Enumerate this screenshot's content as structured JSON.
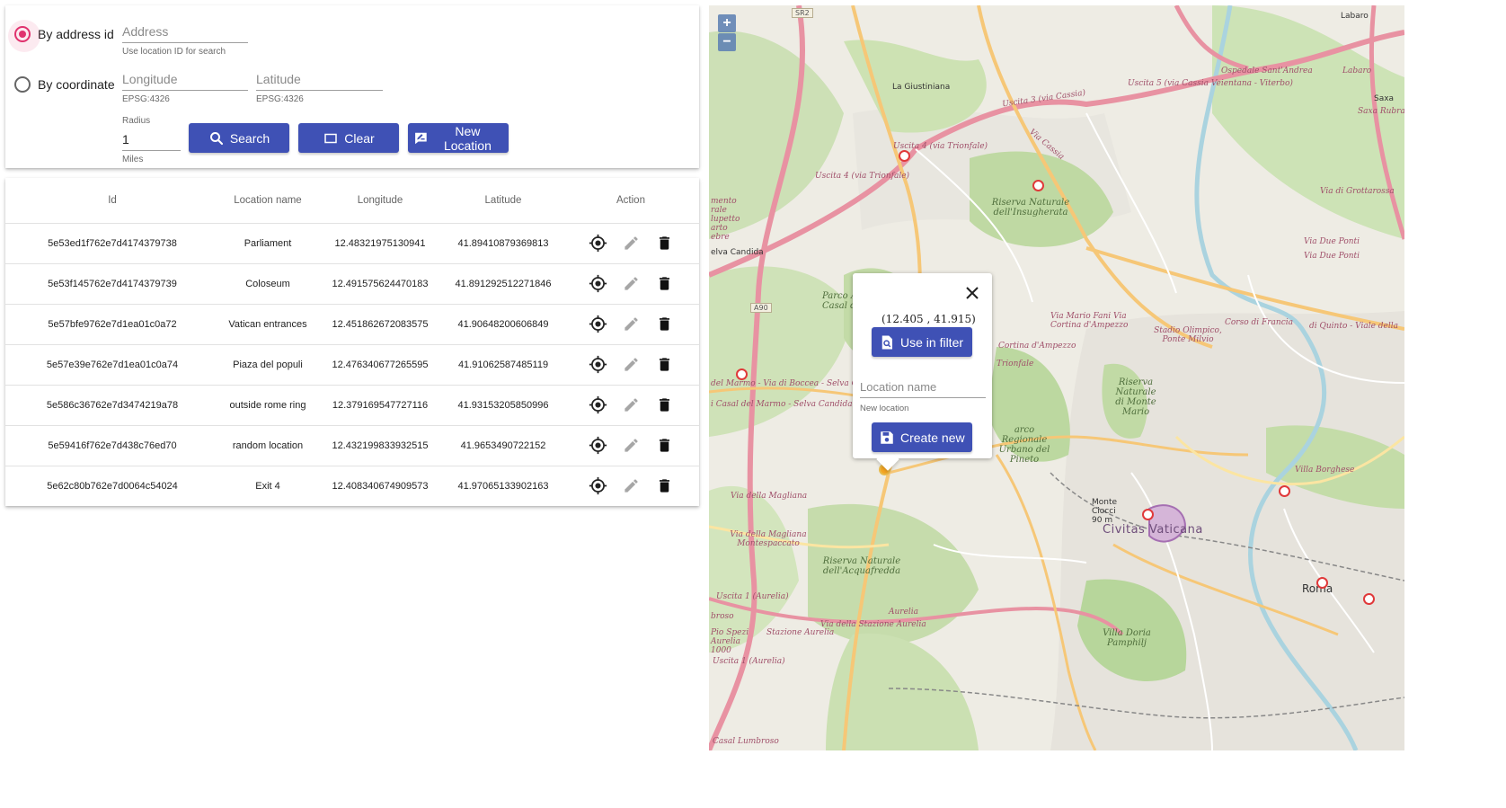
{
  "filter": {
    "mode_address_label": "By address id",
    "mode_coordinate_label": "By coordinate",
    "address_placeholder": "Address",
    "address_helper": "Use location ID for search",
    "longitude_placeholder": "Longitude",
    "longitude_helper": "EPSG:4326",
    "latitude_placeholder": "Latitude",
    "latitude_helper": "EPSG:4326",
    "radius_label": "Radius",
    "radius_value": "1",
    "radius_unit": "Miles",
    "search_label": "Search",
    "clear_label": "Clear",
    "new_location_label": "New Location",
    "accent_color": "#3f51b5",
    "radio_color": "#e0336f"
  },
  "table": {
    "headers": {
      "id": "Id",
      "name": "Location name",
      "longitude": "Longitude",
      "latitude": "Latitude",
      "action": "Action"
    },
    "rows": [
      {
        "id": "5e53ed1f762e7d4174379738",
        "name": "Parliament",
        "longitude": "12.48321975130941",
        "latitude": "41.89410879369813"
      },
      {
        "id": "5e53f145762e7d4174379739",
        "name": "Coloseum",
        "longitude": "12.491575624470183",
        "latitude": "41.891292512271846"
      },
      {
        "id": "5e57bfe9762e7d1ea01c0a72",
        "name": "Vatican entrances",
        "longitude": "12.451862672083575",
        "latitude": "41.90648200606849"
      },
      {
        "id": "5e57e39e762e7d1ea01c0a74",
        "name": "Piaza del populi",
        "longitude": "12.476340677265595",
        "latitude": "41.91062587485119"
      },
      {
        "id": "5e586c36762e7d3474219a78",
        "name": "outside rome ring",
        "longitude": "12.379169547727116",
        "latitude": "41.93153205850996"
      },
      {
        "id": "5e59416f762e7d438c76ed70",
        "name": "random location",
        "longitude": "12.432199833932515",
        "latitude": "41.9653490722152"
      },
      {
        "id": "5e62c80b762e7d0064c54024",
        "name": "Exit 4",
        "longitude": "12.408340674909573",
        "latitude": "41.97065133902163"
      }
    ]
  },
  "map": {
    "zoom_in": "+",
    "zoom_out": "−",
    "popup": {
      "coords": "(12.405 , 41.915)",
      "use_in_filter_label": "Use in filter",
      "location_name_placeholder": "Location name",
      "location_name_helper": "New location",
      "create_new_label": "Create new"
    },
    "labels": {
      "sr2": "SR2",
      "a90": "A90",
      "giustiniana": "La Giustiniana",
      "uscita3": "Uscita 3 (via Cassia)",
      "uscita4a": "Uscita 4 (via Trionfale)",
      "uscita4b": "Uscita 4 (via Trionfale)",
      "uscita5": "Uscita 5 (via Cassia Veientana - Viterbo)",
      "ospedale": "Ospedale Sant'Andrea",
      "labaro1": "Labaro",
      "labaro2": "Labaro",
      "saxa": "Saxa",
      "saxa_rubra": "Saxa Rubra",
      "grottarossa": "Via di Grottarossa",
      "insugherata": "Riserva Naturale dell'Insugherata",
      "via_cassia": "Via Cassia",
      "mento": "mento rale lupetto arto ebre",
      "elva": "elva Candida",
      "parco": "Parco Agricolo di Casal del Marmo",
      "cortina": "Via Mario Fani Via Cortina d'Ampezzo",
      "cortina2": "Cortina d'Ampezzo",
      "trionfale": "Trionfale",
      "stadio": "Stadio Olimpico, Ponte Milvio",
      "corso_francia": "Corso di Francia",
      "quinto": "di Quinto - Viale della",
      "due_ponti1": "Via Due Ponti",
      "due_ponti2": "Via Due Ponti",
      "montemario": "Riserva Naturale di Monte Mario",
      "pineto": "arco Regionale Urbano del Pineto",
      "boccea": "del Marmo - Via di Boccea - Selva Ca",
      "casal": "i Casal del Marmo - Selva Candida",
      "magliana1": "Via della Magliana",
      "magliana2": "Via della Magliana Montespaccato",
      "acquafredda": "Riserva Naturale dell'Acquafredda",
      "monte_ciocci": "Monte Ciocci 90 m",
      "vaticana": "Civitas Vaticana",
      "villa_borghese": "Villa Borghese",
      "roma": "Roma",
      "uscita1": "Uscita 1 (Aurelia)",
      "uscita1b": "Uscita 1 (Aurelia)",
      "aurelia": "Aurelia",
      "stazione": "Via della Stazione Aurelia",
      "stazione2": "Stazione Aurelia",
      "villa_doria": "Villa Doria Pamphilj",
      "lumbroso": "Casal Lumbroso",
      "pio": "Pio Spezi Aurelia 1000",
      "broso": "broso"
    }
  }
}
